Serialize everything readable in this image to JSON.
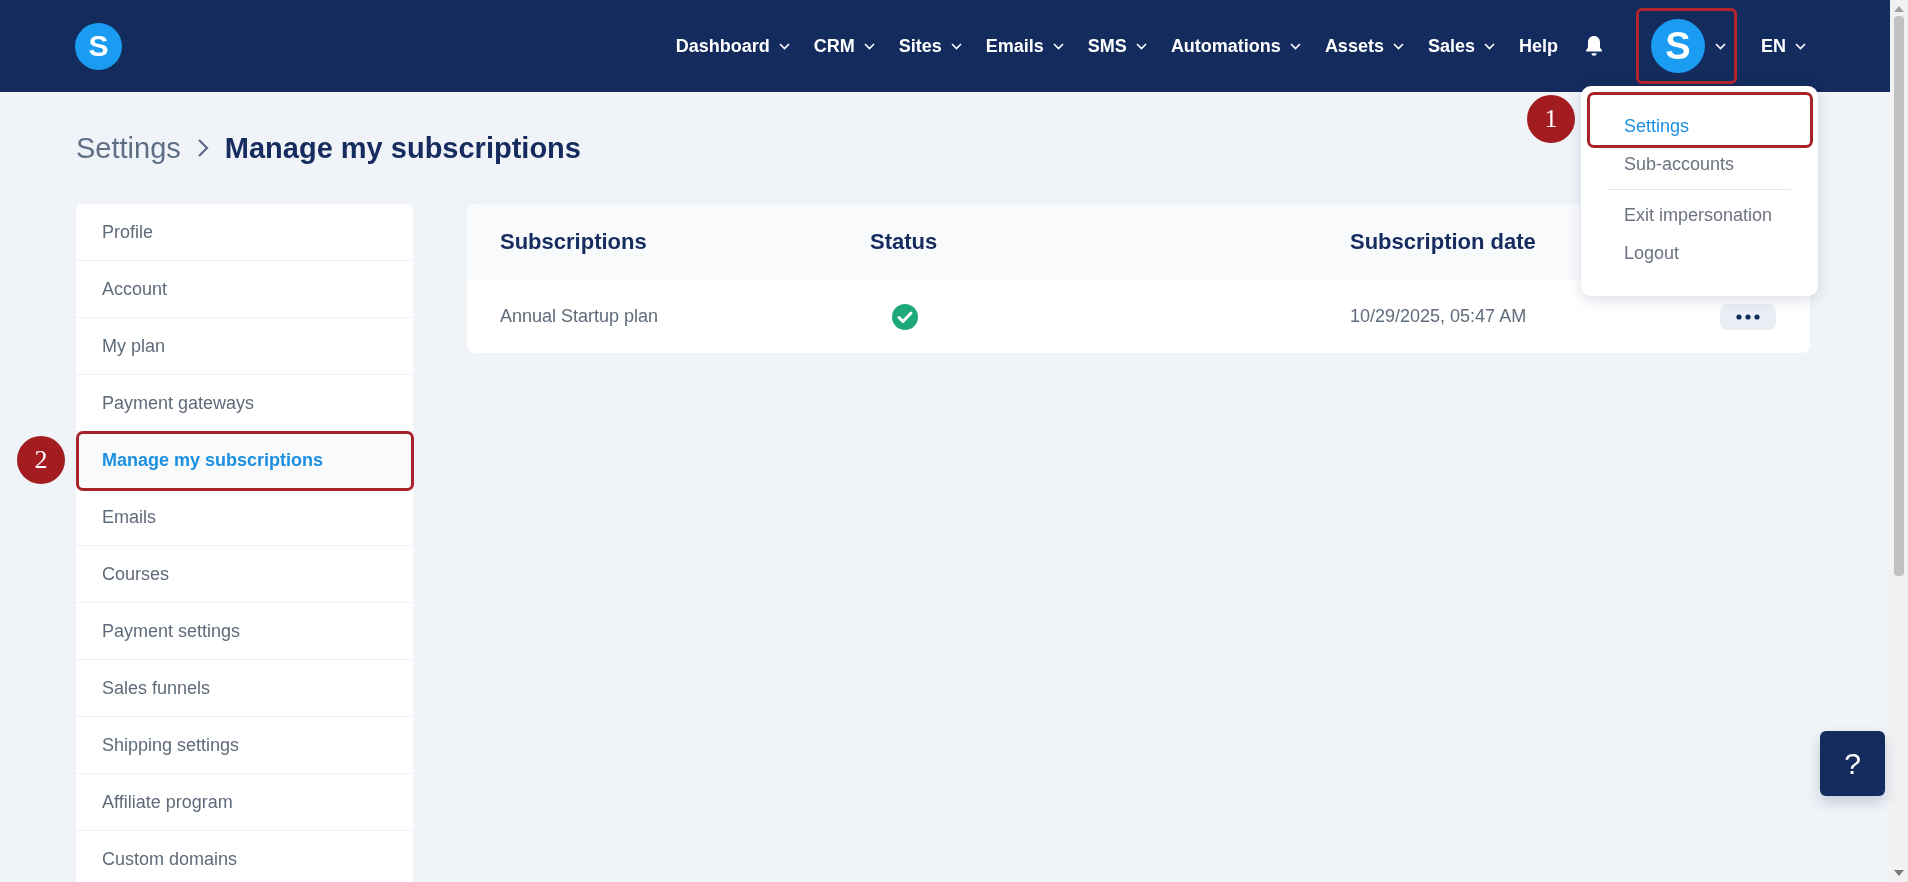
{
  "topbar": {
    "logo_letter": "S",
    "nav": [
      {
        "label": "Dashboard",
        "has_caret": true
      },
      {
        "label": "CRM",
        "has_caret": true
      },
      {
        "label": "Sites",
        "has_caret": true
      },
      {
        "label": "Emails",
        "has_caret": true
      },
      {
        "label": "SMS",
        "has_caret": true
      },
      {
        "label": "Automations",
        "has_caret": true
      },
      {
        "label": "Assets",
        "has_caret": true
      },
      {
        "label": "Sales",
        "has_caret": true
      },
      {
        "label": "Help",
        "has_caret": false
      }
    ],
    "avatar": {
      "letter": "S",
      "highlighted": true
    },
    "language": "EN"
  },
  "user_menu": {
    "groups": [
      [
        {
          "label": "Settings",
          "selected": true,
          "callout": "1"
        },
        {
          "label": "Sub-accounts",
          "selected": false
        }
      ],
      [
        {
          "label": "Exit impersonation",
          "selected": false
        },
        {
          "label": "Logout",
          "selected": false
        }
      ]
    ]
  },
  "breadcrumb": [
    "Settings",
    "Manage my subscriptions"
  ],
  "sidebar": {
    "items": [
      {
        "label": "Profile",
        "selected": false
      },
      {
        "label": "Account",
        "selected": false
      },
      {
        "label": "My plan",
        "selected": false
      },
      {
        "label": "Payment gateways",
        "selected": false
      },
      {
        "label": "Manage my subscriptions",
        "selected": true,
        "callout": "2"
      },
      {
        "label": "Emails",
        "selected": false
      },
      {
        "label": "Courses",
        "selected": false
      },
      {
        "label": "Payment settings",
        "selected": false
      },
      {
        "label": "Sales funnels",
        "selected": false
      },
      {
        "label": "Shipping settings",
        "selected": false
      },
      {
        "label": "Affiliate program",
        "selected": false
      },
      {
        "label": "Custom domains",
        "selected": false
      }
    ]
  },
  "table": {
    "columns": [
      "Subscriptions",
      "Status",
      "Subscription date"
    ],
    "rows": [
      {
        "name": "Annual Startup plan",
        "active": true,
        "date": "10/29/2025, 05:47 AM"
      }
    ]
  },
  "help_button": "?"
}
